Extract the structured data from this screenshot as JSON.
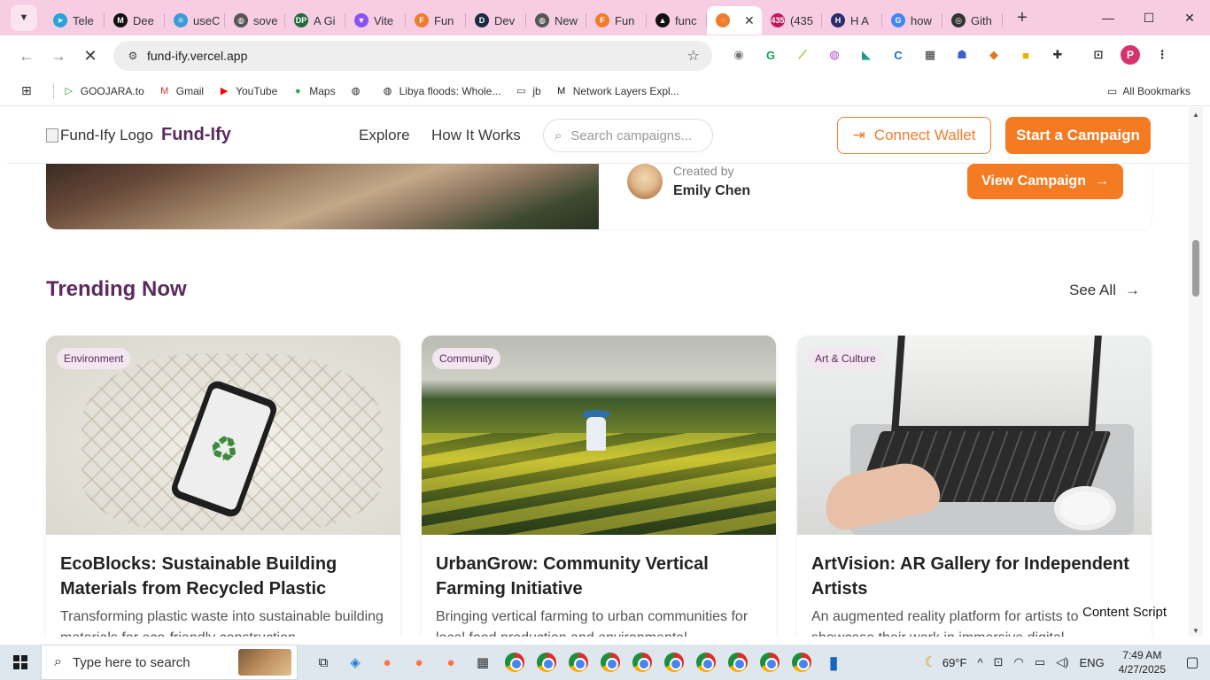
{
  "browser": {
    "tabs": [
      {
        "title": "Tele",
        "icon": "telegram-icon",
        "color": "#2aa1da",
        "glyph": "➤"
      },
      {
        "title": "Dee",
        "icon": "medium-icon",
        "color": "#111111",
        "glyph": "M"
      },
      {
        "title": "useC",
        "icon": "react-icon",
        "color": "#3a9bd5",
        "glyph": "⚛"
      },
      {
        "title": "sove",
        "icon": "globe-icon",
        "color": "#555555",
        "glyph": "◍"
      },
      {
        "title": "A Gi",
        "icon": "dp-icon",
        "color": "#1f6b3a",
        "glyph": "DP"
      },
      {
        "title": "Vite",
        "icon": "vite-icon",
        "color": "#8a52f5",
        "glyph": "▼"
      },
      {
        "title": "Fun",
        "icon": "fundify-icon",
        "color": "#f07d2e",
        "glyph": "F"
      },
      {
        "title": "Dev",
        "icon": "dev-icon",
        "color": "#1a2a44",
        "glyph": "D"
      },
      {
        "title": "New",
        "icon": "globe-icon",
        "color": "#555555",
        "glyph": "◍"
      },
      {
        "title": "Fun",
        "icon": "fundify-icon",
        "color": "#f07d2e",
        "glyph": "F"
      },
      {
        "title": "func",
        "icon": "vercel-icon",
        "color": "#111111",
        "glyph": "▲"
      },
      {
        "title": "",
        "icon": "loading-icon",
        "color": "#f07d2e",
        "glyph": "◌",
        "active": true
      },
      {
        "title": "(435",
        "icon": "counter-icon",
        "color": "#c2185b",
        "glyph": "435"
      },
      {
        "title": "H A",
        "icon": "h-icon",
        "color": "#2b2b6b",
        "glyph": "H"
      },
      {
        "title": "how",
        "icon": "google-icon",
        "color": "#4285f4",
        "glyph": "G"
      },
      {
        "title": "Gith",
        "icon": "github-icon",
        "color": "#333333",
        "glyph": "◎"
      }
    ],
    "url": "fund-ify.vercel.app",
    "bookmarks": [
      {
        "label": "GOOJARA.to",
        "icon": "play-icon",
        "glyph": "▷",
        "color": "#1e8e3e"
      },
      {
        "label": "Gmail",
        "icon": "gmail-icon",
        "glyph": "M",
        "color": "#d93025"
      },
      {
        "label": "YouTube",
        "icon": "youtube-icon",
        "glyph": "▶",
        "color": "#ff0000"
      },
      {
        "label": "Maps",
        "icon": "maps-icon",
        "glyph": "●",
        "color": "#34a853"
      },
      {
        "label": "",
        "icon": "globe-icon",
        "glyph": "◍",
        "color": "#222222"
      },
      {
        "label": "Libya floods: Whole...",
        "icon": "globe-icon",
        "glyph": "◍",
        "color": "#222222"
      },
      {
        "label": "jb",
        "icon": "folder-icon",
        "glyph": "▭",
        "color": "#444444"
      },
      {
        "label": "Network Layers Expl...",
        "icon": "medium-icon",
        "glyph": "M",
        "color": "#111111"
      }
    ],
    "all_bookmarks": "All Bookmarks"
  },
  "site": {
    "logo_alt": "Fund-Ify Logo",
    "brand": "Fund-Ify",
    "nav": [
      "Explore",
      "How It Works"
    ],
    "search_placeholder": "Search campaigns...",
    "connect_wallet": "Connect Wallet",
    "start_campaign": "Start a Campaign",
    "featured": {
      "created_by_label": "Created by",
      "creator": "Emily Chen",
      "view_label": "View Campaign"
    },
    "trending": {
      "title": "Trending Now",
      "see_all": "See All",
      "cards": [
        {
          "category": "Environment",
          "title": "EcoBlocks: Sustainable Building Materials from Recycled Plastic",
          "desc": "Transforming plastic waste into sustainable building materials for eco-friendly construction."
        },
        {
          "category": "Community",
          "title": "UrbanGrow: Community Vertical Farming Initiative",
          "desc": "Bringing vertical farming to urban communities for local food production and environmental"
        },
        {
          "category": "Art & Culture",
          "title": "ArtVision: AR Gallery for Independent Artists",
          "desc": "An augmented reality platform for artists to showcase their work in immersive digital"
        }
      ]
    },
    "overlay_text": "Content Script"
  },
  "taskbar": {
    "search_placeholder": "Type here to search",
    "weather": "69°F",
    "language": "ENG",
    "time": "7:49 AM",
    "date": "4/27/2025",
    "weather_badge": "1"
  }
}
